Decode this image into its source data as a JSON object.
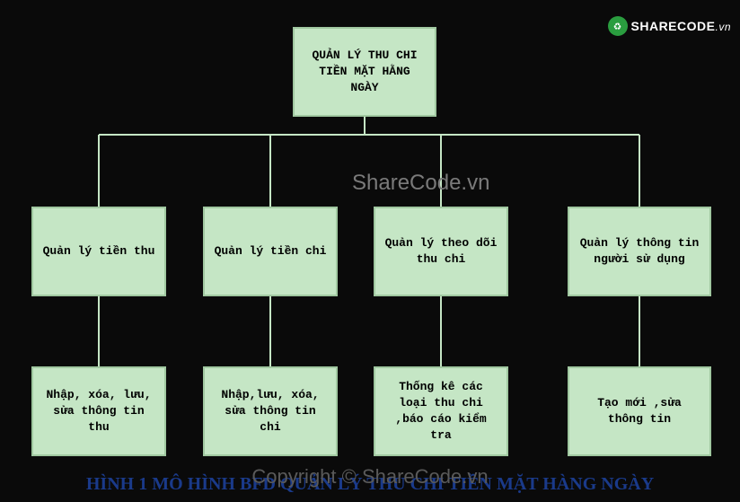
{
  "logo": {
    "text": "SHARECODE",
    "suffix": ".vn"
  },
  "watermark": {
    "center": "ShareCode.vn",
    "bottom": "Copyright © ShareCode.vn"
  },
  "diagram": {
    "root": "QUẢN LÝ THU CHI TIỀN MẶT HẰNG NGÀY",
    "level2": {
      "n1": "Quản lý tiền thu",
      "n2": "Quản lý tiền chi",
      "n3": "Quản lý theo dõi thu chi",
      "n4": "Quản lý thông tin người sử dụng"
    },
    "level3": {
      "n1": "Nhập, xóa, lưu, sửa thông tin thu",
      "n2": "Nhập,lưu, xóa, sửa thông tin chi",
      "n3": "Thống kê các loại thu chi ,báo cáo kiểm tra",
      "n4": "Tạo mới ,sửa thông tin"
    }
  },
  "caption": "HÌNH  1 MÔ HÌNH BFD QUẢN LÝ THU CHI TIỀN MẶT HÀNG NGÀY"
}
